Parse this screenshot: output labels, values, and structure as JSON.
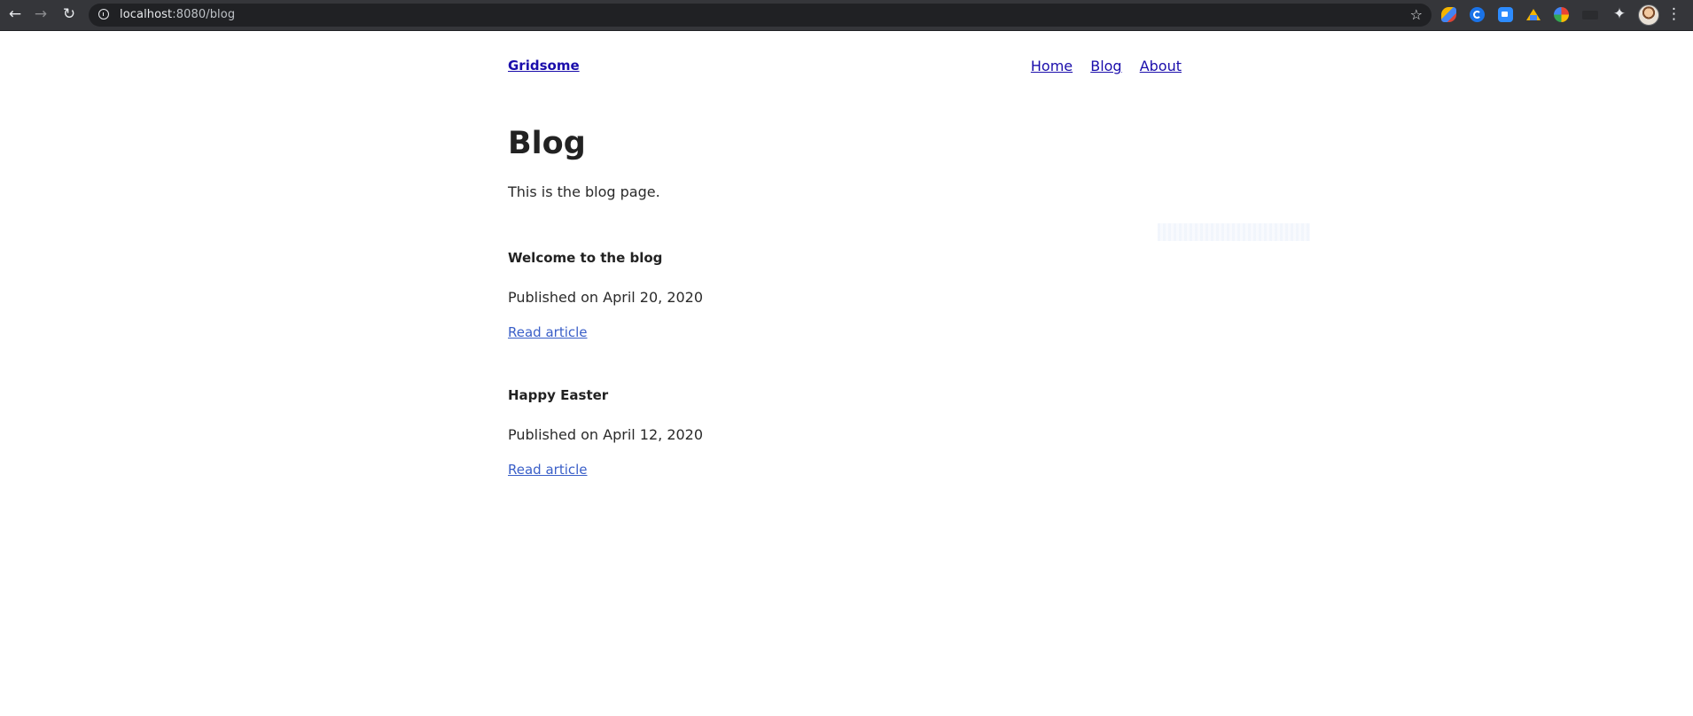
{
  "browser": {
    "url_host": "localhost",
    "url_rest": ":8080/blog",
    "icons": {
      "back": "back-arrow-icon",
      "forward": "forward-arrow-icon",
      "reload": "reload-icon",
      "info": "site-info-icon",
      "bookmark": "star-icon",
      "extensions": "puzzle-icon",
      "menu": "kebab-menu-icon"
    }
  },
  "site": {
    "brand": "Gridsome",
    "nav": [
      "Home",
      "Blog",
      "About"
    ]
  },
  "main": {
    "title": "Blog",
    "intro": "This is the blog page.",
    "posts": [
      {
        "title": "Welcome to the blog",
        "date": "Published on April 20, 2020",
        "link": "Read article"
      },
      {
        "title": "Happy Easter",
        "date": "Published on April 12, 2020",
        "link": "Read article"
      }
    ]
  },
  "colors": {
    "link": "#1a0dab",
    "article_link": "#3a5fc8",
    "chrome_bg": "#35363a",
    "omnibox_bg": "#202124"
  }
}
